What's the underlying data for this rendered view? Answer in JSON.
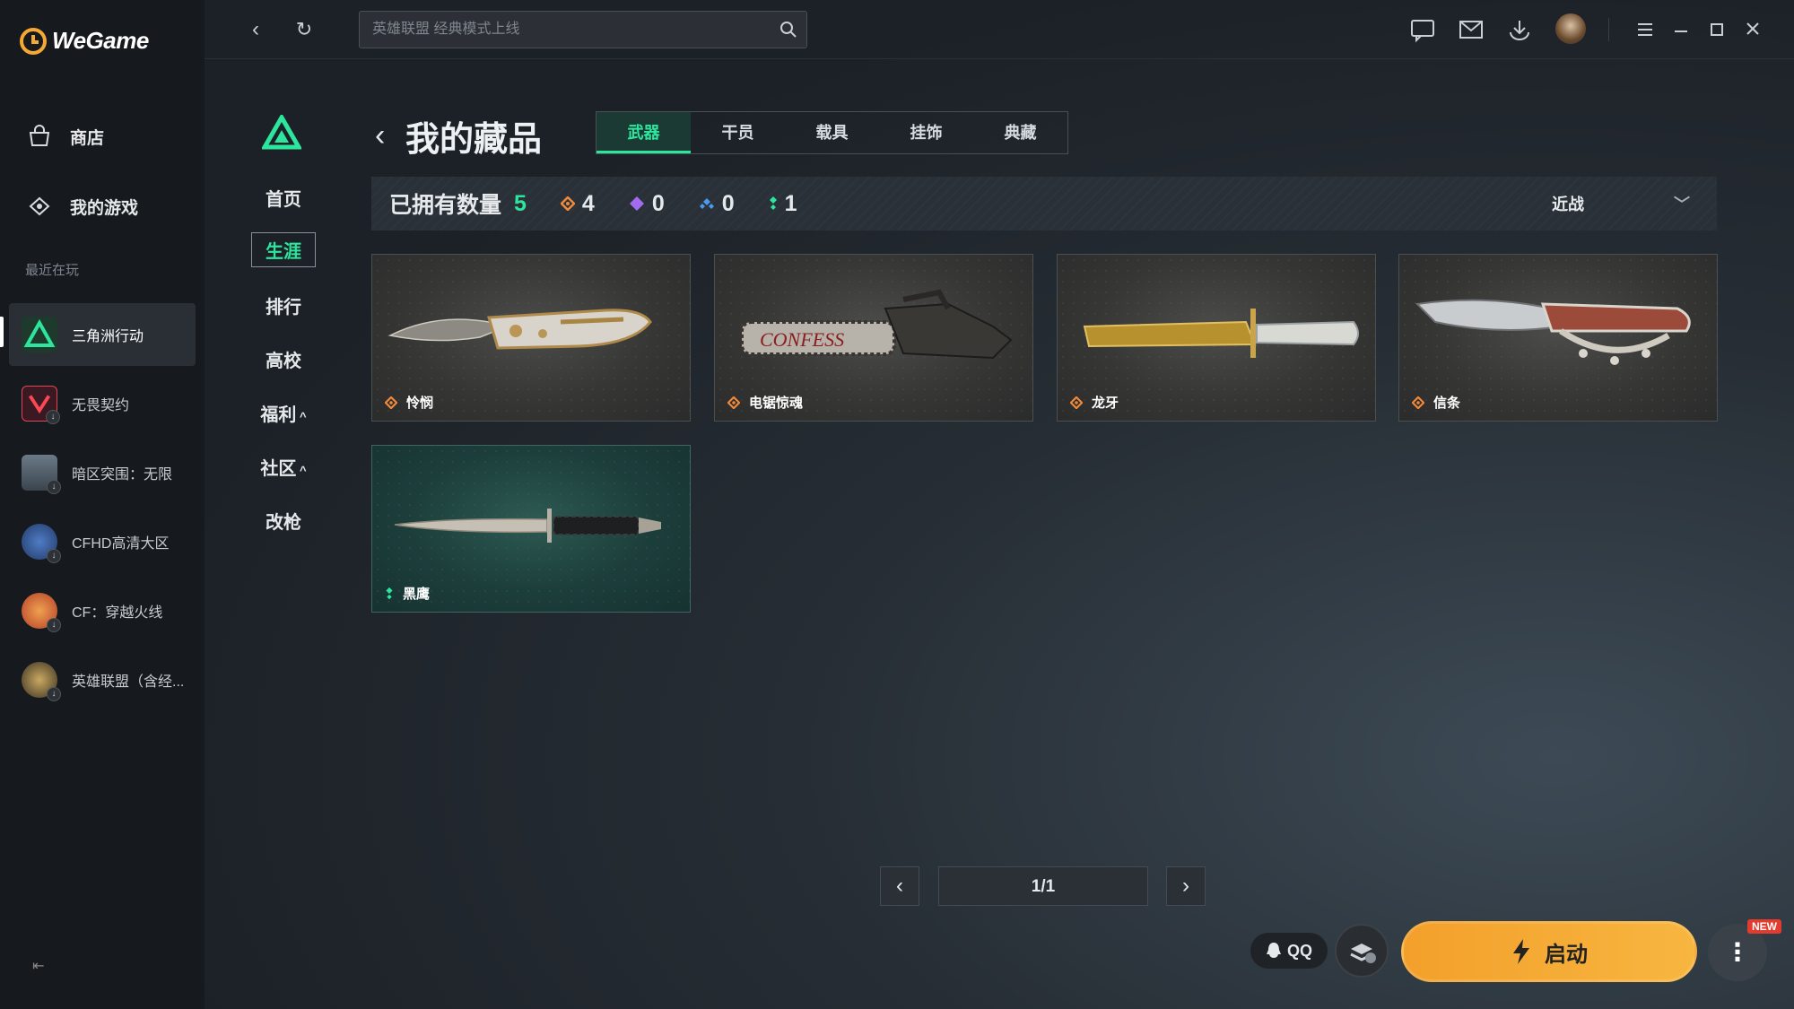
{
  "app": {
    "name": "WeGame"
  },
  "sidebar": {
    "nav": [
      {
        "label": "商店",
        "icon": "store-icon"
      },
      {
        "label": "我的游戏",
        "icon": "gamepad-icon"
      }
    ],
    "recent_label": "最近在玩",
    "games": [
      {
        "label": "三角洲行动",
        "icon": "delta-force-icon",
        "active": true
      },
      {
        "label": "无畏契约",
        "icon": "valorant-icon"
      },
      {
        "label": "暗区突围：无限",
        "icon": "arena-breakout-icon"
      },
      {
        "label": "CFHD高清大区",
        "icon": "cfhd-icon"
      },
      {
        "label": "CF：穿越火线",
        "icon": "crossfire-icon"
      },
      {
        "label": "英雄联盟（含经...",
        "icon": "lol-icon"
      }
    ]
  },
  "topbar": {
    "search_placeholder": "英雄联盟 经典模式上线"
  },
  "game_nav": {
    "items": [
      "首页",
      "生涯",
      "排行",
      "高校",
      "福利",
      "社区",
      "改枪"
    ],
    "active": "生涯"
  },
  "collection": {
    "title": "我的藏品",
    "tabs": [
      "武器",
      "干员",
      "载具",
      "挂饰",
      "典藏"
    ],
    "active_tab": "武器",
    "owned_label": "已拥有数量",
    "owned_total": "5",
    "rarity_counts": [
      {
        "icon": "orange-diamond-icon",
        "color": "#f08a3a",
        "count": "4"
      },
      {
        "icon": "purple-diamond-icon",
        "color": "#a36cf0",
        "count": "0"
      },
      {
        "icon": "blue-diamond-icon",
        "color": "#4a9af0",
        "count": "0"
      },
      {
        "icon": "green-diamond-icon",
        "color": "#2ee59d",
        "count": "1"
      }
    ],
    "filter": "近战",
    "items": [
      {
        "name": "怜悯",
        "rarity_color": "#f08a3a"
      },
      {
        "name": "电锯惊魂",
        "rarity_color": "#f08a3a"
      },
      {
        "name": "龙牙",
        "rarity_color": "#f08a3a"
      },
      {
        "name": "信条",
        "rarity_color": "#f08a3a"
      },
      {
        "name": "黑鹰",
        "rarity_color": "#2ee59d"
      }
    ],
    "page": "1/1"
  },
  "bottom": {
    "qq_label": "QQ",
    "launch_label": "启动",
    "new_badge": "NEW"
  },
  "colors": {
    "accent": "#2ee59d",
    "launch": "#f5a833"
  }
}
